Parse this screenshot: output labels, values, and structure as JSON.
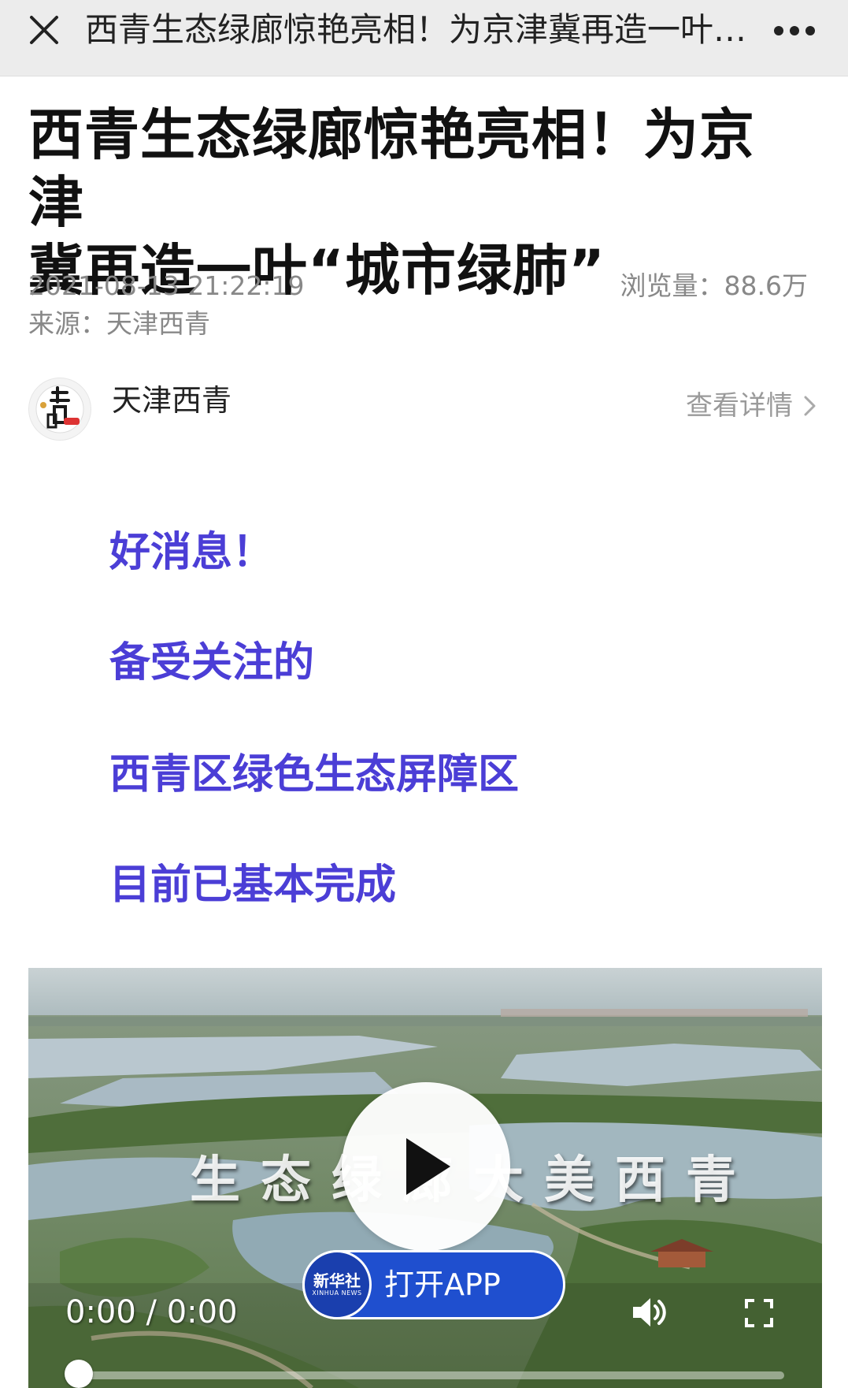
{
  "topbar": {
    "title": "西青生态绿廊惊艳亮相！为京津冀再造一叶“城市绿肺”",
    "close_icon": "close-icon",
    "more_icon": "more-icon"
  },
  "article": {
    "title_line1": "西青生态绿廊惊艳亮相！为京津",
    "title_line2": "冀再造一叶“城市绿肺”",
    "date": "2021-08-13 21:22:19",
    "views": "浏览量：88.6万",
    "source": "来源：天津西青"
  },
  "account": {
    "name": "天津西青",
    "details_label": "查看详情",
    "avatar_icon": "account-logo-icon",
    "chevron_icon": "chevron-right-icon"
  },
  "highlights": [
    "好消息！",
    "备受关注的",
    "西青区绿色生态屏障区",
    "目前已基本完成"
  ],
  "video": {
    "caption": "生态绿廊大美西青",
    "open_app_label": "打开APP",
    "logo_main": "新华社",
    "logo_sub": "XINHUA NEWS",
    "time": "0:00 / 0:00",
    "progress": 0,
    "play_icon": "play-icon",
    "volume_icon": "volume-icon",
    "fullscreen_icon": "fullscreen-icon"
  },
  "colors": {
    "highlight_text": "#4b3ed6",
    "open_app_bg": "#1f4fcf",
    "meta_text": "#888888"
  }
}
